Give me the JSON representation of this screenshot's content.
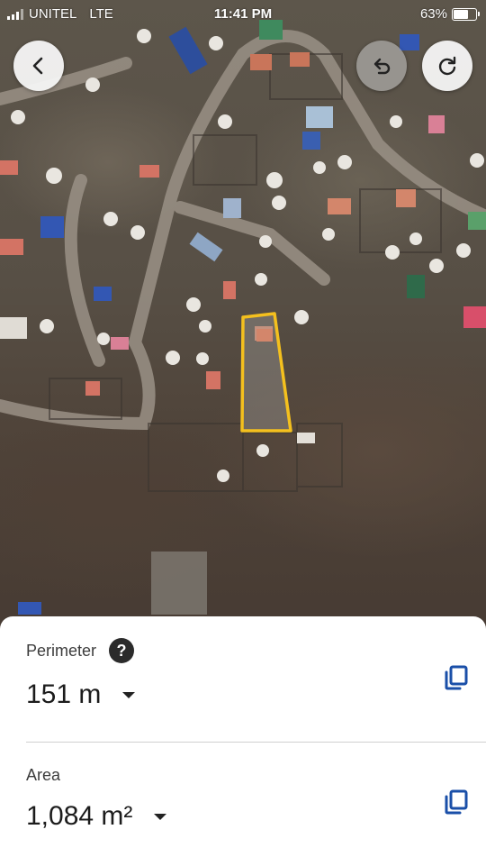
{
  "status_bar": {
    "carrier": "UNITEL",
    "network": "LTE",
    "time": "11:41 PM",
    "battery": "63%",
    "battery_level": 0.63
  },
  "toolbar": {
    "back_icon": "chevron-left-icon",
    "undo_icon": "undo-icon",
    "redo_icon": "redo-icon"
  },
  "measurement": {
    "perimeter": {
      "label": "Perimeter",
      "value": "151 m",
      "help_glyph": "?"
    },
    "area": {
      "label": "Area",
      "value": "1,084 m²"
    }
  },
  "colors": {
    "polygon_outline": "#f4c01e",
    "icon_blue": "#1a4fa8",
    "sheet_bg": "#ffffff"
  }
}
